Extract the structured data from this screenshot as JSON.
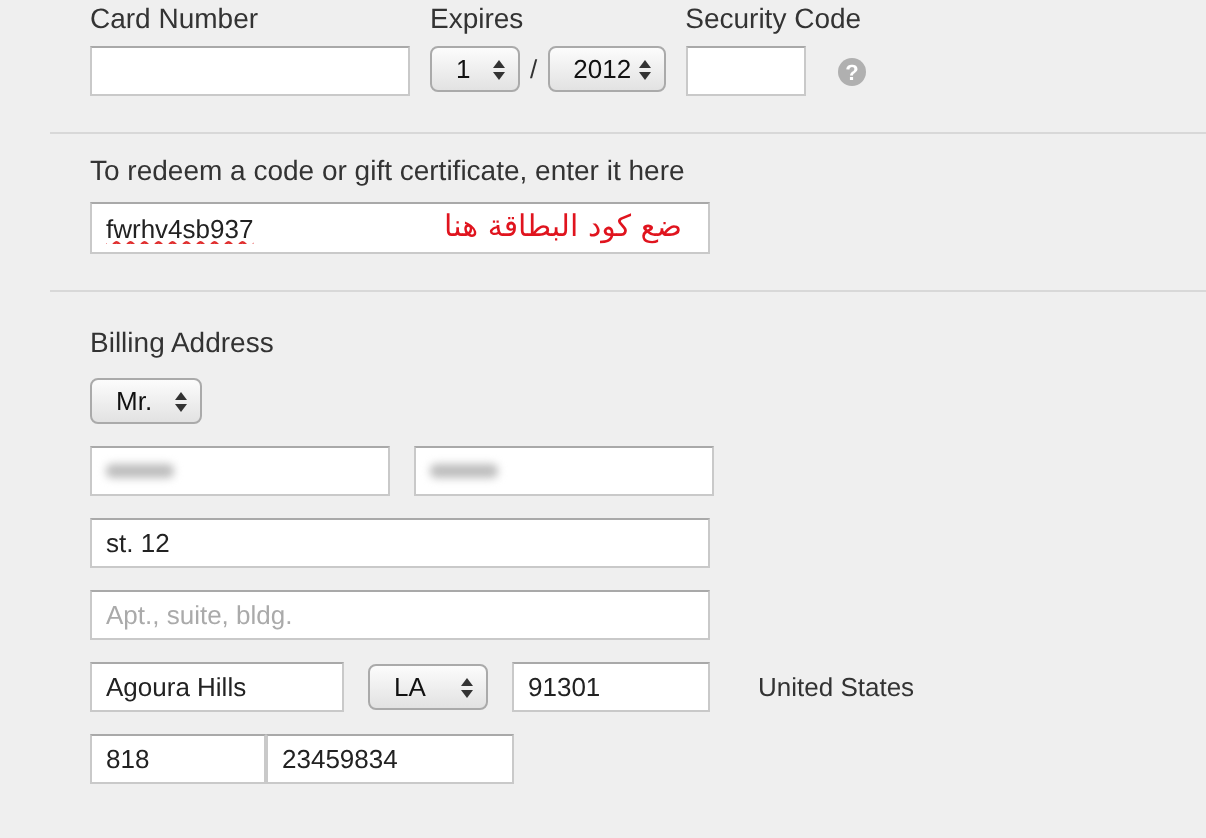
{
  "payment": {
    "card_number": {
      "label": "Card Number"
    },
    "expires": {
      "label": "Expires",
      "month": "1",
      "separator": "/",
      "year": "2012"
    },
    "security_code": {
      "label": "Security Code",
      "help": "?"
    }
  },
  "redeem": {
    "label": "To redeem a code or gift certificate, enter it here",
    "value": "fwrhv4sb937",
    "spellcheck_error": true,
    "annotation": "ضع كود البطاقة هنا"
  },
  "billing": {
    "title": "Billing Address",
    "salutation": "Mr.",
    "name_fields": [
      {
        "blurred": true
      },
      {
        "blurred": true
      }
    ],
    "street": {
      "value": "st. 12"
    },
    "street2": {
      "placeholder": "Apt., suite, bldg."
    },
    "city": {
      "value": "Agoura Hills"
    },
    "state": "LA",
    "zip": {
      "value": "91301"
    },
    "country": "United States",
    "phone": [
      {
        "value": "818"
      },
      {
        "value": "23459834"
      }
    ]
  }
}
